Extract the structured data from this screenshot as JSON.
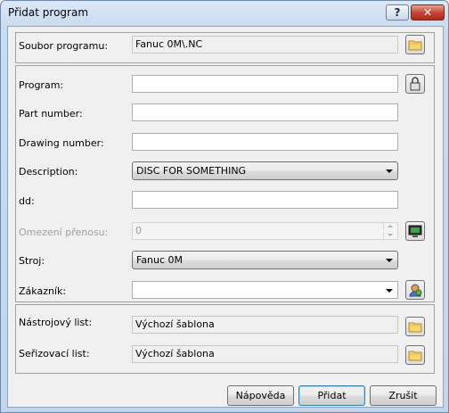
{
  "window": {
    "title": "Přidat program",
    "help_button": "?",
    "close_button": "✕"
  },
  "file": {
    "label": "Soubor programu:",
    "value": "Fanuc 0M\\.NC"
  },
  "form": {
    "program_label": "Program:",
    "program_value": "",
    "part_number_label": "Part number:",
    "part_number_value": "",
    "drawing_number_label": "Drawing number:",
    "drawing_number_value": "",
    "description_label": "Description:",
    "description_value": "DISC FOR SOMETHING",
    "dd_label": "dd:",
    "dd_value": "",
    "limit_label": "Omezení přenosu:",
    "limit_value": "0",
    "machine_label": "Stroj:",
    "machine_value": "Fanuc 0M",
    "customer_label": "Zákazník:",
    "customer_value": ""
  },
  "lists": {
    "tool_label": "Nástrojový list:",
    "tool_value": "Výchozí šablona",
    "setup_label": "Seřizovací list:",
    "setup_value": "Výchozí šablona"
  },
  "buttons": {
    "help": "Nápověda",
    "add": "Přidat",
    "cancel": "Zrušit"
  },
  "icons": {
    "file_browse": "folder-icon",
    "program_lock": "lock-icon",
    "limit_settings": "monitor-icon",
    "customer_lookup": "user-icon",
    "tool_browse": "folder-icon",
    "setup_browse": "folder-icon"
  },
  "colors": {
    "window_frame": "#c3d6ec",
    "client": "#f0f0f0",
    "folder": "#f5d76e",
    "close_button": "#c6463a"
  }
}
